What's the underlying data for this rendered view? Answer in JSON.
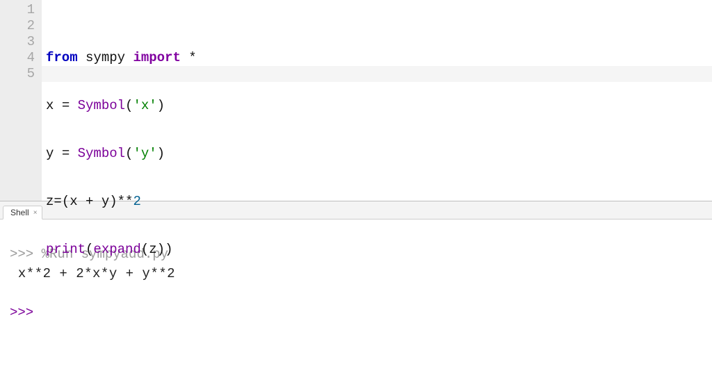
{
  "editor": {
    "line_numbers": [
      "1",
      "2",
      "3",
      "4",
      "5"
    ],
    "highlight_line_index": 4,
    "tokens": {
      "from": "from",
      "sympy": "sympy",
      "import": "import",
      "star": "*",
      "x": "x",
      "y": "y",
      "z": "z",
      "eq": "=",
      "symbol": "Symbol",
      "lp": "(",
      "rp": ")",
      "str_x": "'x'",
      "str_y": "'y'",
      "plus": "+",
      "starstar": "**",
      "two": "2",
      "print": "print",
      "expand": "expand"
    }
  },
  "tabs": {
    "shell": {
      "label": "Shell",
      "close": "×"
    }
  },
  "shell": {
    "prompt": ">>>",
    "run_cmd": "%Run sympyadd.py",
    "output": "x**2 + 2*x*y + y**2",
    "prompt2": ">>>"
  }
}
